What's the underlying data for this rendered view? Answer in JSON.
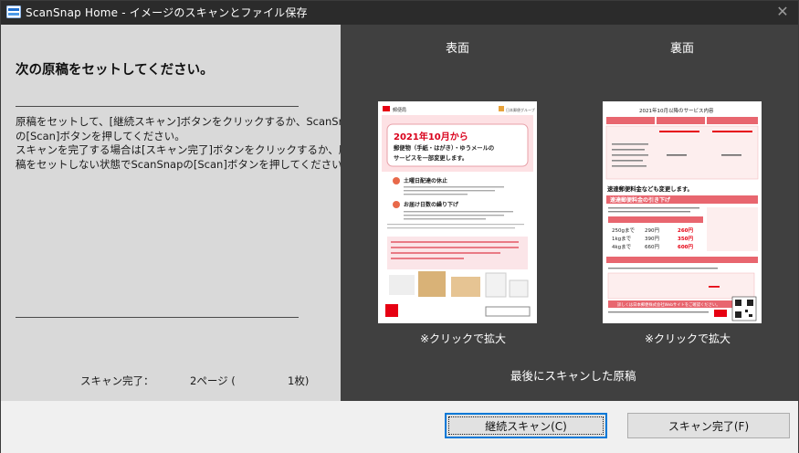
{
  "window": {
    "title": "ScanSnap Home - イメージのスキャンとファイル保存",
    "close_glyph": "✕"
  },
  "left": {
    "heading": "次の原稿をセットしてください。",
    "instructions": [
      "原稿をセットして、[継続スキャン]ボタンをクリックするか、ScanSnap",
      "の[Scan]ボタンを押してください。",
      "スキャンを完了する場合は[スキャン完了]ボタンをクリックするか、原",
      "稿をセットしない状態でScanSnapの[Scan]ボタンを押してください。"
    ],
    "status": {
      "label": "スキャン完了：",
      "pages": "2ページ (",
      "sheets": "1枚)"
    }
  },
  "preview": {
    "front_label": "表面",
    "back_label": "裏面",
    "zoom_hint": "※クリックで拡大",
    "caption": "最後にスキャンした原稿",
    "front_page": {
      "header_left": "郵便局",
      "header_right": "日本郵便グループ",
      "headline_1": "2021年10月から",
      "headline_2": "郵便物（手紙・はがき）・ゆうメールの",
      "headline_3": "サービスを一部変更します。",
      "item_1": "土曜日配達の休止",
      "item_2": "お届け日数の繰り下げ"
    },
    "back_page": {
      "title": "2021年10月以降のサービス内容",
      "section_1": "速達郵便料金なども変更します。",
      "section_2": "速達郵便料金の引き下げ",
      "rows": [
        {
          "weight": "250gまで",
          "old": "290円",
          "new": "260円"
        },
        {
          "weight": "1kgまで",
          "old": "390円",
          "new": "350円"
        },
        {
          "weight": "4kgまで",
          "old": "660円",
          "new": "600円"
        }
      ],
      "note": "詳しくは日本郵便株式会社Webサイトをご確認ください。"
    }
  },
  "buttons": {
    "continue": "継続スキャン(C)",
    "finish": "スキャン完了(F)"
  },
  "colors": {
    "accent": "#0078d7",
    "brand_red": "#e60012"
  }
}
